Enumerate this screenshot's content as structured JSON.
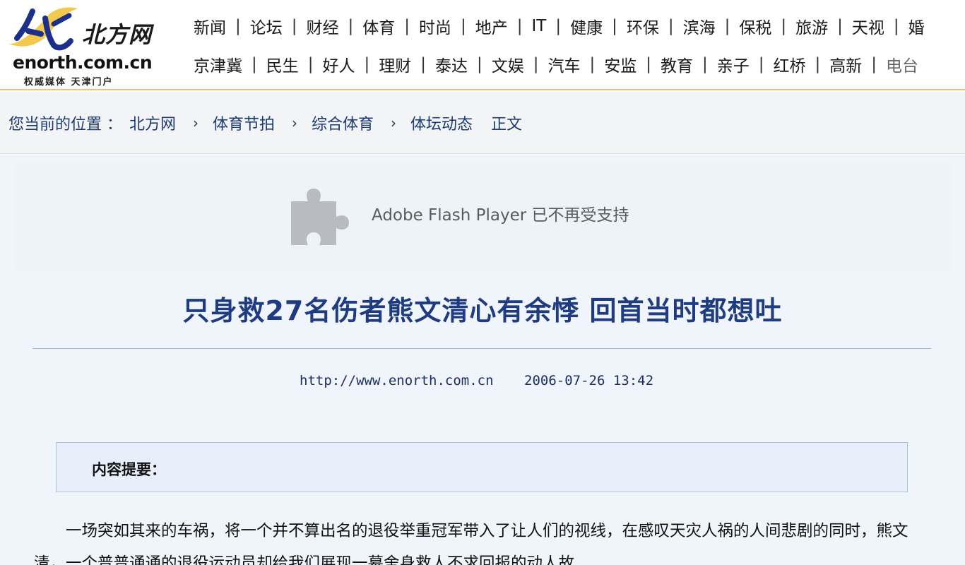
{
  "logo": {
    "mark": "北",
    "name_cn": "北方网",
    "domain": "enorth.com.cn",
    "slogan": "权威媒体  天津门户"
  },
  "nav": {
    "row1": [
      "新闻",
      "论坛",
      "财经",
      "体育",
      "时尚",
      "地产",
      "IT",
      "健康",
      "环保",
      "滨海",
      "保税",
      "旅游",
      "天视",
      "婚"
    ],
    "row2": [
      "京津冀",
      "民生",
      "好人",
      "理财",
      "泰达",
      "文娱",
      "汽车",
      "安监",
      "教育",
      "亲子",
      "红桥",
      "高新",
      "电台"
    ]
  },
  "breadcrumb": {
    "label": "您当前的位置 ：",
    "items": [
      "北方网",
      "体育节拍",
      "综合体育",
      "体坛动态"
    ],
    "current": "正文"
  },
  "flash": {
    "icon": "puzzle-icon",
    "message": "Adobe Flash Player 已不再受支持"
  },
  "article": {
    "title": "只身救27名伤者熊文清心有余悸  回首当时都想吐",
    "source_url": "http://www.enorth.com.cn",
    "datetime": "2006-07-26 13:42",
    "summary_label": "内容提要：",
    "body": "一场突如其来的车祸，将一个并不算出名的退役举重冠军带入了让人们的视线，在感叹天灾人祸的人间悲剧的同时，熊文清，一个普普通通的退役运动员却给我们展现一幕舍身救人不求回报的动人故"
  },
  "colors": {
    "accent_gold": "#f0c66b",
    "title_blue": "#1f3c82",
    "panel_bg": "#eff5fb"
  }
}
